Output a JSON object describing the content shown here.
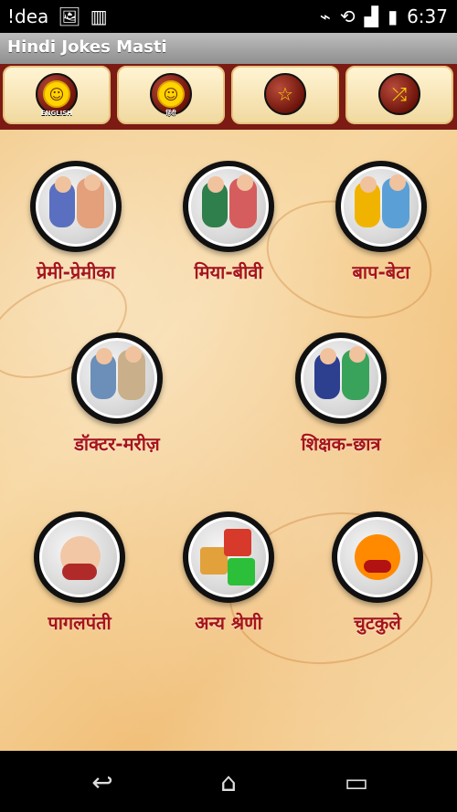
{
  "status_bar": {
    "carrier_text": "!dea",
    "time": "6:37",
    "icons": [
      "image-icon",
      "barcode-icon",
      "bluetooth-icon",
      "sync-off-icon",
      "signal-icon",
      "battery-icon"
    ]
  },
  "app_bar": {
    "title": "Hindi Jokes Masti"
  },
  "top_menu": [
    {
      "name": "English",
      "label": "ENGLISH",
      "icon": "smiley-english-icon"
    },
    {
      "name": "Hindi",
      "label": "हिंदी",
      "icon": "smiley-hindi-icon"
    },
    {
      "name": "Favourites",
      "label": "",
      "icon": "star-icon"
    },
    {
      "name": "Shuffle",
      "label": "",
      "icon": "shuffle-icon"
    }
  ],
  "categories": [
    {
      "label": "प्रेमी-प्रेमीका",
      "icon": "lovers-illustration-icon"
    },
    {
      "label": "मिया-बीवी",
      "icon": "husband-wife-illustration-icon"
    },
    {
      "label": "बाप-बेटा",
      "icon": "father-son-illustration-icon"
    },
    {
      "label": "डॉक्टर-मरीज़",
      "icon": "doctor-patient-illustration-icon"
    },
    {
      "label": "शिक्षक-छात्र",
      "icon": "teacher-student-illustration-icon"
    },
    {
      "label": "पागलपंती",
      "icon": "crazy-face-illustration-icon"
    },
    {
      "label": "अन्य श्रेणी",
      "icon": "boxes-illustration-icon"
    },
    {
      "label": "चुटकुले",
      "icon": "laughing-emoji-illustration-icon"
    }
  ],
  "nav_bar": {
    "back": "back-icon",
    "home": "home-icon",
    "recents": "recents-icon"
  }
}
